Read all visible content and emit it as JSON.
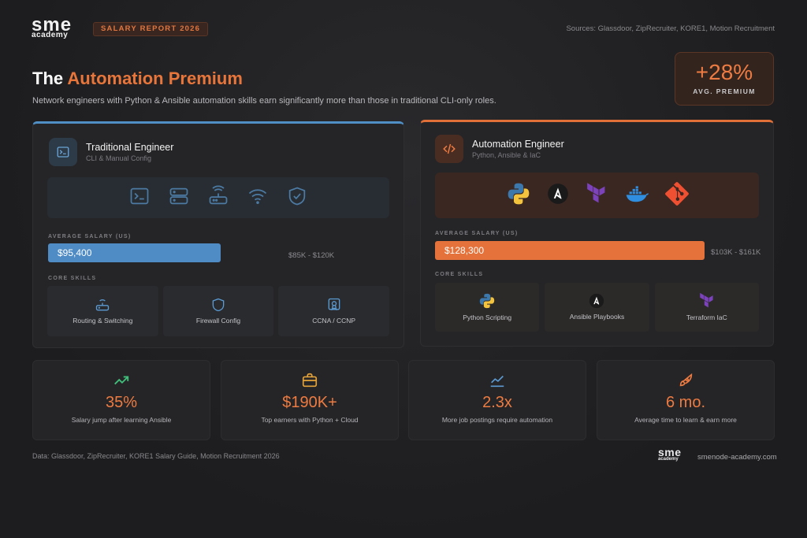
{
  "brand": {
    "logo_top": "sme",
    "logo_bottom": "academy"
  },
  "header": {
    "report_tag": "SALARY REPORT 2026",
    "sources": "Sources: Glassdoor, ZipRecruiter, KORE1, Motion Recruitment",
    "title_plain": "The ",
    "title_accent": "Automation Premium",
    "subtitle": "Network engineers with Python & Ansible automation skills earn significantly more than those in traditional CLI-only roles."
  },
  "premium": {
    "value": "+28%",
    "label": "AVG. PREMIUM"
  },
  "traditional": {
    "title": "Traditional Engineer",
    "subtitle": "CLI & Manual Config",
    "tool_icons": [
      "terminal-icon",
      "server-icon",
      "router-icon",
      "wifi-icon",
      "shield-check-icon"
    ],
    "salary_label": "AVERAGE SALARY (US)",
    "salary": "$95,400",
    "salary_fraction": 0.74,
    "range": "$85K - $120K",
    "skills_label": "CORE SKILLS",
    "skills": [
      {
        "icon": "router-icon",
        "label": "Routing & Switching"
      },
      {
        "icon": "shield-icon",
        "label": "Firewall Config"
      },
      {
        "icon": "certificate-icon",
        "label": "CCNA / CCNP"
      }
    ],
    "accent": "#4f8cc6"
  },
  "automation": {
    "title": "Automation Engineer",
    "subtitle": "Python, Ansible & IaC",
    "tool_icons": [
      "python-icon",
      "ansible-icon",
      "terraform-icon",
      "docker-icon",
      "git-icon"
    ],
    "salary_label": "AVERAGE SALARY (US)",
    "salary": "$128,300",
    "salary_fraction": 1.0,
    "range": "$103K - $161K",
    "skills_label": "CORE SKILLS",
    "skills": [
      {
        "icon": "python-icon",
        "label": "Python Scripting"
      },
      {
        "icon": "ansible-icon",
        "label": "Ansible Playbooks"
      },
      {
        "icon": "terraform-icon",
        "label": "Terraform IaC"
      }
    ],
    "accent": "#e4723a"
  },
  "stats": [
    {
      "icon": "trending-up-icon",
      "value": "35%",
      "label": "Salary jump after learning Ansible"
    },
    {
      "icon": "briefcase-icon",
      "value": "$190K+",
      "label": "Top earners with Python + Cloud"
    },
    {
      "icon": "line-chart-icon",
      "value": "2.3x",
      "label": "More job postings require automation"
    },
    {
      "icon": "rocket-icon",
      "value": "6 mo.",
      "label": "Average time to learn & earn more"
    }
  ],
  "footer": {
    "data_note": "Data: Glassdoor, ZipRecruiter, KORE1 Salary Guide, Motion Recruitment 2026",
    "logo_top": "sme",
    "logo_bottom": "academy",
    "url": "smenode-academy.com"
  }
}
